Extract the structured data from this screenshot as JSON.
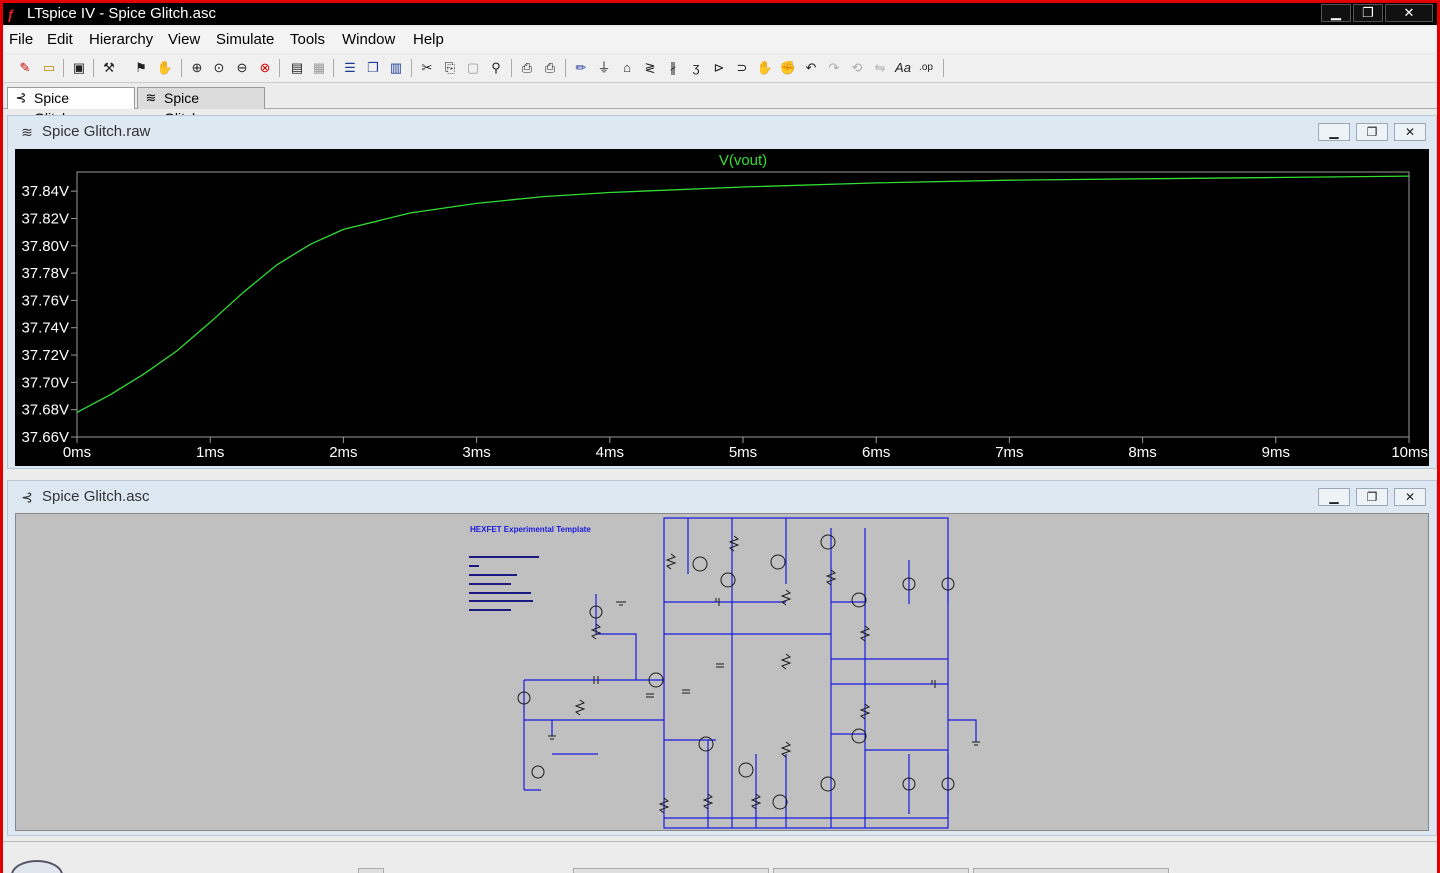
{
  "window": {
    "title": "LTspice IV - Spice Glitch.asc",
    "minimize": "▁",
    "restore": "❐",
    "close": "✕"
  },
  "menu": [
    "File",
    "Edit",
    "Hierarchy",
    "View",
    "Simulate",
    "Tools",
    "Window",
    "Help"
  ],
  "tabs": [
    {
      "label": "Spice Glitch.asc",
      "icon": "schematic-icon",
      "active": true
    },
    {
      "label": "Spice Glitch.raw",
      "icon": "waveform-icon",
      "active": false
    }
  ],
  "plot_window": {
    "title": "Spice Glitch.raw",
    "trace_label": "V(vout)",
    "trace_color": "#33dd33",
    "minimize": "▁",
    "restore": "❐",
    "close": "✕"
  },
  "schematic_window": {
    "title": "Spice Glitch.asc",
    "heading": "HEXFET Experimental Template",
    "minimize": "▁",
    "restore": "❐",
    "close": "✕"
  },
  "chart_data": {
    "type": "line",
    "title": "V(vout)",
    "xlabel": "",
    "ylabel": "",
    "x_ticks": [
      "0ms",
      "1ms",
      "2ms",
      "3ms",
      "4ms",
      "5ms",
      "6ms",
      "7ms",
      "8ms",
      "9ms",
      "10ms"
    ],
    "y_ticks": [
      "37.66V",
      "37.68V",
      "37.70V",
      "37.72V",
      "37.74V",
      "37.76V",
      "37.78V",
      "37.80V",
      "37.82V",
      "37.84V"
    ],
    "xlim": [
      0,
      10
    ],
    "ylim": [
      37.66,
      37.854
    ],
    "grid": false,
    "series": [
      {
        "name": "V(vout)",
        "color": "#33dd33",
        "x": [
          0,
          0.25,
          0.5,
          0.75,
          1.0,
          1.25,
          1.5,
          1.75,
          2.0,
          2.5,
          3.0,
          3.5,
          4.0,
          5.0,
          6.0,
          7.0,
          8.0,
          9.0,
          10.0
        ],
        "y": [
          37.678,
          37.691,
          37.706,
          37.723,
          37.744,
          37.766,
          37.786,
          37.801,
          37.812,
          37.824,
          37.831,
          37.836,
          37.839,
          37.843,
          37.846,
          37.848,
          37.849,
          37.85,
          37.851
        ]
      }
    ]
  }
}
